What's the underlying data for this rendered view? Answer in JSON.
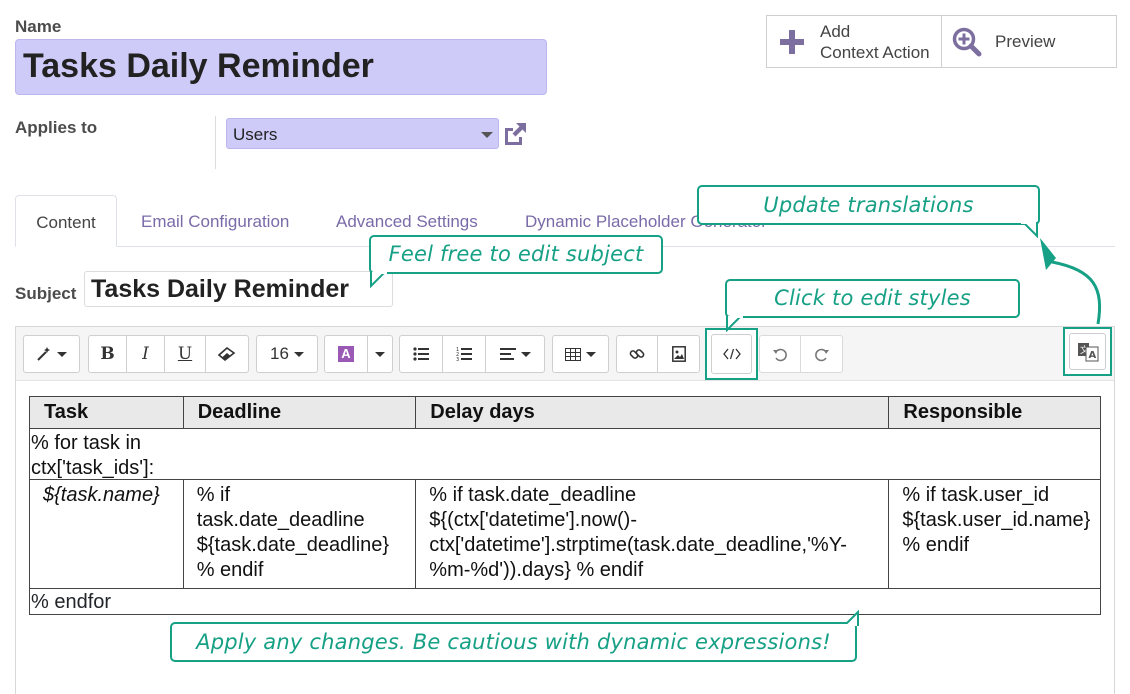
{
  "form": {
    "name_label": "Name",
    "name_value": "Tasks Daily Reminder",
    "applies_label": "Applies to",
    "applies_value": "Users",
    "subject_label": "Subject",
    "subject_value": "Tasks Daily Reminder"
  },
  "buttons": {
    "context_line1": "Add",
    "context_line2": "Context Action",
    "preview": "Preview"
  },
  "tabs": [
    {
      "label": "Content",
      "active": true
    },
    {
      "label": "Email Configuration"
    },
    {
      "label": "Advanced Settings"
    },
    {
      "label": "Dynamic Placeholder Generator"
    }
  ],
  "toolbar": {
    "font_size": "16",
    "icons": [
      "magic-wand-icon",
      "bold-icon",
      "italic-icon",
      "underline-icon",
      "eraser-icon",
      "font-size-dropdown",
      "text-color-icon",
      "bullet-list-icon",
      "numbered-list-icon",
      "align-icon",
      "table-icon",
      "link-icon",
      "image-icon",
      "code-view-icon",
      "undo-icon",
      "redo-icon",
      "translate-icon"
    ]
  },
  "template_table": {
    "headers": [
      "Task",
      "Deadline",
      "Delay days",
      "Responsible"
    ],
    "loop_start": "% for task in\nctx['task_ids']:",
    "cells": [
      "${task.name}",
      "% if\ntask.date_deadline\n${task.date_deadline}\n% endif",
      "% if task.date_deadline\n${(ctx['datetime'].now()-\nctx['datetime'].strptime(task.date_deadline,'%Y-\n%m-%d')).days} % endif",
      "% if task.user_id\n${task.user_id.name}\n% endif"
    ],
    "loop_end": "% endfor"
  },
  "callouts": {
    "subject": "Feel free to edit subject",
    "styles": "Click to edit styles",
    "translate": "Update translations",
    "apply": "Apply any changes. Be cautious with dynamic expressions!"
  },
  "colors": {
    "field_highlight": "#cfcbf9",
    "callout_accent": "#16a085",
    "tab_link": "#7a6ba8",
    "brand_icon": "#7c6fa0"
  }
}
